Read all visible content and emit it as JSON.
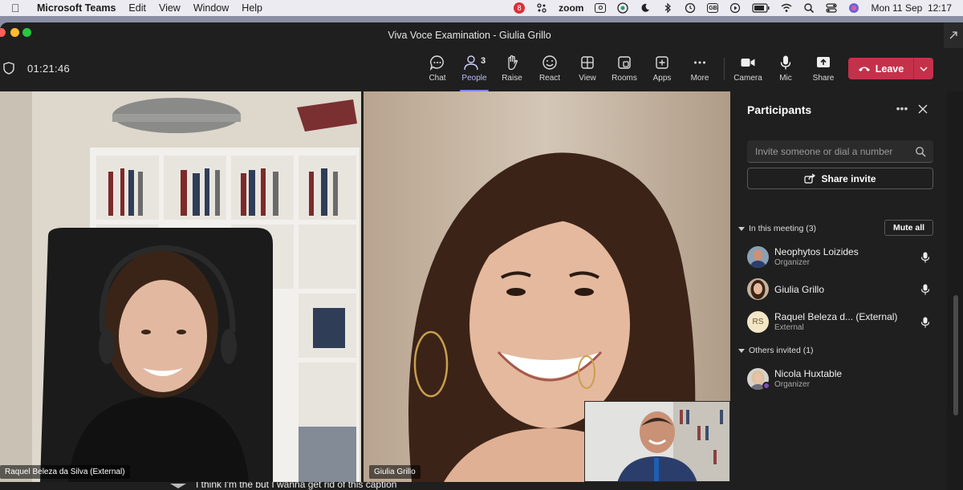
{
  "menubar": {
    "app_name": "Microsoft Teams",
    "items": [
      "Edit",
      "View",
      "Window",
      "Help"
    ],
    "zoom_label": "zoom",
    "badge": "8",
    "flag": "GB",
    "datetime": "Mon 11 Sep  12:17"
  },
  "window": {
    "title": "Viva Voce Examination - Giulia Grillo",
    "timer": "01:21:46"
  },
  "toolbar": {
    "chat": "Chat",
    "people": "People",
    "people_count": "3",
    "raise": "Raise",
    "react": "React",
    "view": "View",
    "rooms": "Rooms",
    "apps": "Apps",
    "more": "More",
    "camera": "Camera",
    "mic": "Mic",
    "share": "Share",
    "leave": "Leave"
  },
  "tiles": {
    "left_name": "Raquel Beleza da Silva (External)",
    "right_name": "Giulia Grillo"
  },
  "caption": "I think I'm the but I wanna get rid of this caption",
  "panel": {
    "title": "Participants",
    "search_placeholder": "Invite someone or dial a number",
    "share_invite": "Share invite",
    "in_meeting": "In this meeting (3)",
    "mute_all": "Mute all",
    "others_invited": "Others invited (1)",
    "participants": [
      {
        "name": "Neophytos Loizides",
        "role": "Organizer"
      },
      {
        "name": "Giulia Grillo",
        "role": ""
      },
      {
        "name": "Raquel Beleza d... (External)",
        "role": "External",
        "initials": "RS"
      }
    ],
    "invited": [
      {
        "name": "Nicola Huxtable",
        "role": "Organizer"
      }
    ]
  }
}
